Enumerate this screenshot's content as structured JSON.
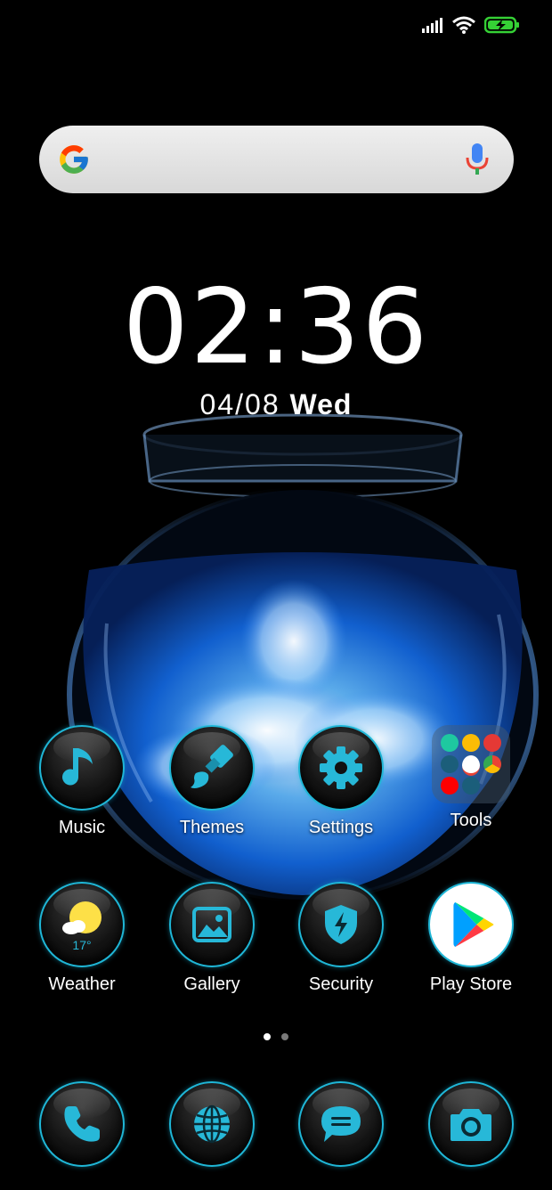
{
  "status_bar": {
    "signal_icon": "signal-bars-icon",
    "wifi_icon": "wifi-icon",
    "battery_icon": "battery-charging-icon",
    "battery_color": "#35d035"
  },
  "search_bar": {
    "logo_icon": "google-g-icon",
    "mic_icon": "microphone-icon",
    "placeholder": ""
  },
  "clock": {
    "time": "02:36",
    "date": "04/08",
    "day": "Wed"
  },
  "apps_row1": [
    {
      "label": "Music",
      "icon": "music-note-icon"
    },
    {
      "label": "Themes",
      "icon": "paintbrush-icon"
    },
    {
      "label": "Settings",
      "icon": "gear-icon"
    },
    {
      "label": "Tools",
      "icon": "folder-icon"
    }
  ],
  "apps_row2": [
    {
      "label": "Weather",
      "icon": "weather-sun-cloud-icon",
      "temperature": "17°"
    },
    {
      "label": "Gallery",
      "icon": "image-icon"
    },
    {
      "label": "Security",
      "icon": "shield-bolt-icon"
    },
    {
      "label": "Play Store",
      "icon": "play-store-icon"
    }
  ],
  "dock": [
    {
      "icon": "phone-icon"
    },
    {
      "icon": "globe-icon"
    },
    {
      "icon": "message-icon"
    },
    {
      "icon": "camera-icon"
    }
  ],
  "page_indicator": {
    "pages": 2,
    "active": 1
  },
  "colors": {
    "accent": "#1fb6d6",
    "icon_glyph": "#27b8d8",
    "wallpaper_liquid": "#1a6ed8"
  }
}
